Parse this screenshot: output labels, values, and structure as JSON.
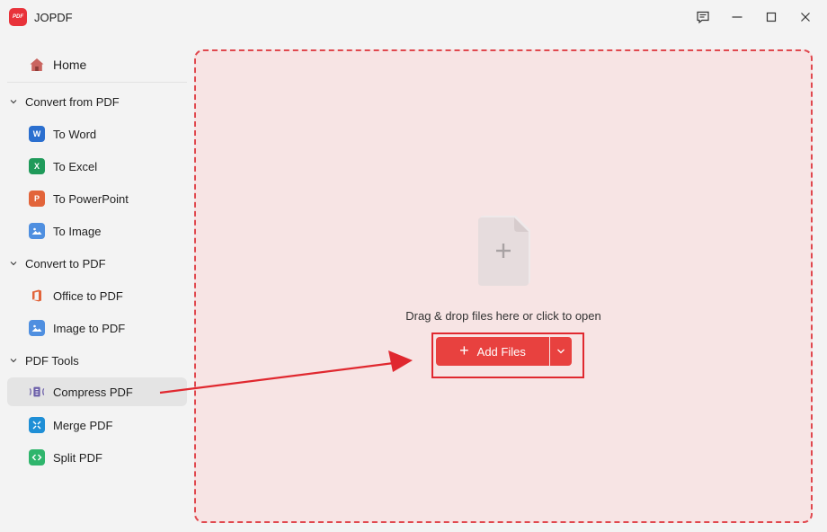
{
  "app": {
    "title": "JOPDF",
    "logo_text": "PDF"
  },
  "sidebar": {
    "home": "Home",
    "sections": [
      {
        "title": "Convert from PDF",
        "items": [
          "To Word",
          "To Excel",
          "To PowerPoint",
          "To Image"
        ]
      },
      {
        "title": "Convert to PDF",
        "items": [
          "Office to PDF",
          "Image to PDF"
        ]
      },
      {
        "title": "PDF Tools",
        "items": [
          "Compress PDF",
          "Merge PDF",
          "Split PDF"
        ]
      }
    ],
    "active_item": "Compress PDF",
    "icon_letters": {
      "word": "W",
      "excel": "X",
      "powerpoint": "P"
    }
  },
  "main": {
    "drop_text": "Drag & drop files here or click to open",
    "add_files_label": "Add Files",
    "add_files_plus": "+"
  },
  "colors": {
    "accent": "#e8413f",
    "dropzone_bg": "#f7e4e4",
    "dropzone_border": "#e0484e",
    "annotation": "#e0282f"
  }
}
